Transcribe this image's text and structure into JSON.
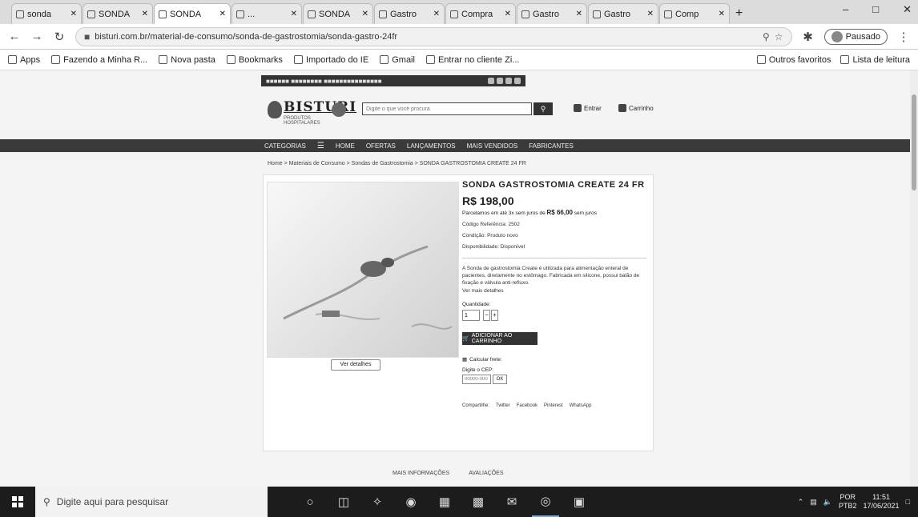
{
  "browser": {
    "tabs": [
      {
        "label": "sonda"
      },
      {
        "label": "SONDA"
      },
      {
        "label": "SONDA",
        "active": true
      },
      {
        "label": "..."
      },
      {
        "label": "SONDA"
      },
      {
        "label": "Gastro"
      },
      {
        "label": "Compra"
      },
      {
        "label": "Gastro"
      },
      {
        "label": "Gastro"
      },
      {
        "label": "Comp"
      }
    ],
    "new_tab": "+",
    "url": "bisturi.com.br/material-de-consumo/sonda-de-gastrostomia/sonda-gastro-24fr",
    "profile_label": "Pausado",
    "bookmarks": [
      {
        "label": "Apps"
      },
      {
        "label": "Fazendo a Minha R..."
      },
      {
        "label": "Nova pasta"
      },
      {
        "label": "Bookmarks"
      },
      {
        "label": "Importado do IE"
      },
      {
        "label": "Gmail"
      },
      {
        "label": "Entrar no cliente Zi..."
      }
    ],
    "bookmarks_right": [
      {
        "label": "Outros favoritos"
      },
      {
        "label": "Lista de leitura"
      }
    ]
  },
  "site": {
    "logo_name": "BISTURI",
    "logo_tag": "PRODUTOS HOSPITALARES",
    "search_placeholder": "Digite o que você procura",
    "enter_label": "Entrar",
    "cart_label": "Carrinho",
    "categories_label": "CATEGORIAS",
    "nav": [
      "HOME",
      "OFERTAS",
      "LANÇAMENTOS",
      "MAIS VENDIDOS",
      "FABRICANTES"
    ],
    "breadcrumb": "Home > Materiais de Consumo > Sondas de Gastrostomia > SONDA GASTROSTOMIA CREATE 24 FR",
    "product": {
      "title": "SONDA GASTROSTOMIA CREATE 24 FR",
      "price": "R$ 198,00",
      "installments_prefix": "Parcelamos em até 3x sem juros de",
      "installments_value": "R$ 66,00",
      "installments_suffix": "sem juros",
      "meta": [
        "Código Referência: 2502",
        "Condição: Produto novo",
        "Disponibilidade: Disponível"
      ],
      "description": "A Sonda de gastrostomia Create é utilizada para alimentação enteral de pacientes, diretamente no estômago. Fabricada em silicone, possui balão de fixação e válvula anti-refluxo.",
      "read_more": "Ver mais detalhes",
      "qty_label": "Quantidade:",
      "qty_value": "1",
      "add_to_cart": "ADICIONAR AO CARRINHO",
      "shipping_label": "Calcular frete:",
      "cep_label": "Digite o CEP:",
      "cep_placeholder": "00000-000",
      "cep_button": "OK",
      "share": [
        "Compartilhe:",
        "Twitter",
        "Facebook",
        "Pinterest",
        "WhatsApp"
      ],
      "zoom_label": "Ver detalhes"
    },
    "bottom_tabs": [
      "MAIS INFORMAÇÕES",
      "AVALIAÇÕES"
    ]
  },
  "taskbar": {
    "search_placeholder": "Digite aqui para pesquisar",
    "lang": [
      "POR",
      "PTB2"
    ],
    "time": "11:51",
    "date": "17/06/2021"
  }
}
